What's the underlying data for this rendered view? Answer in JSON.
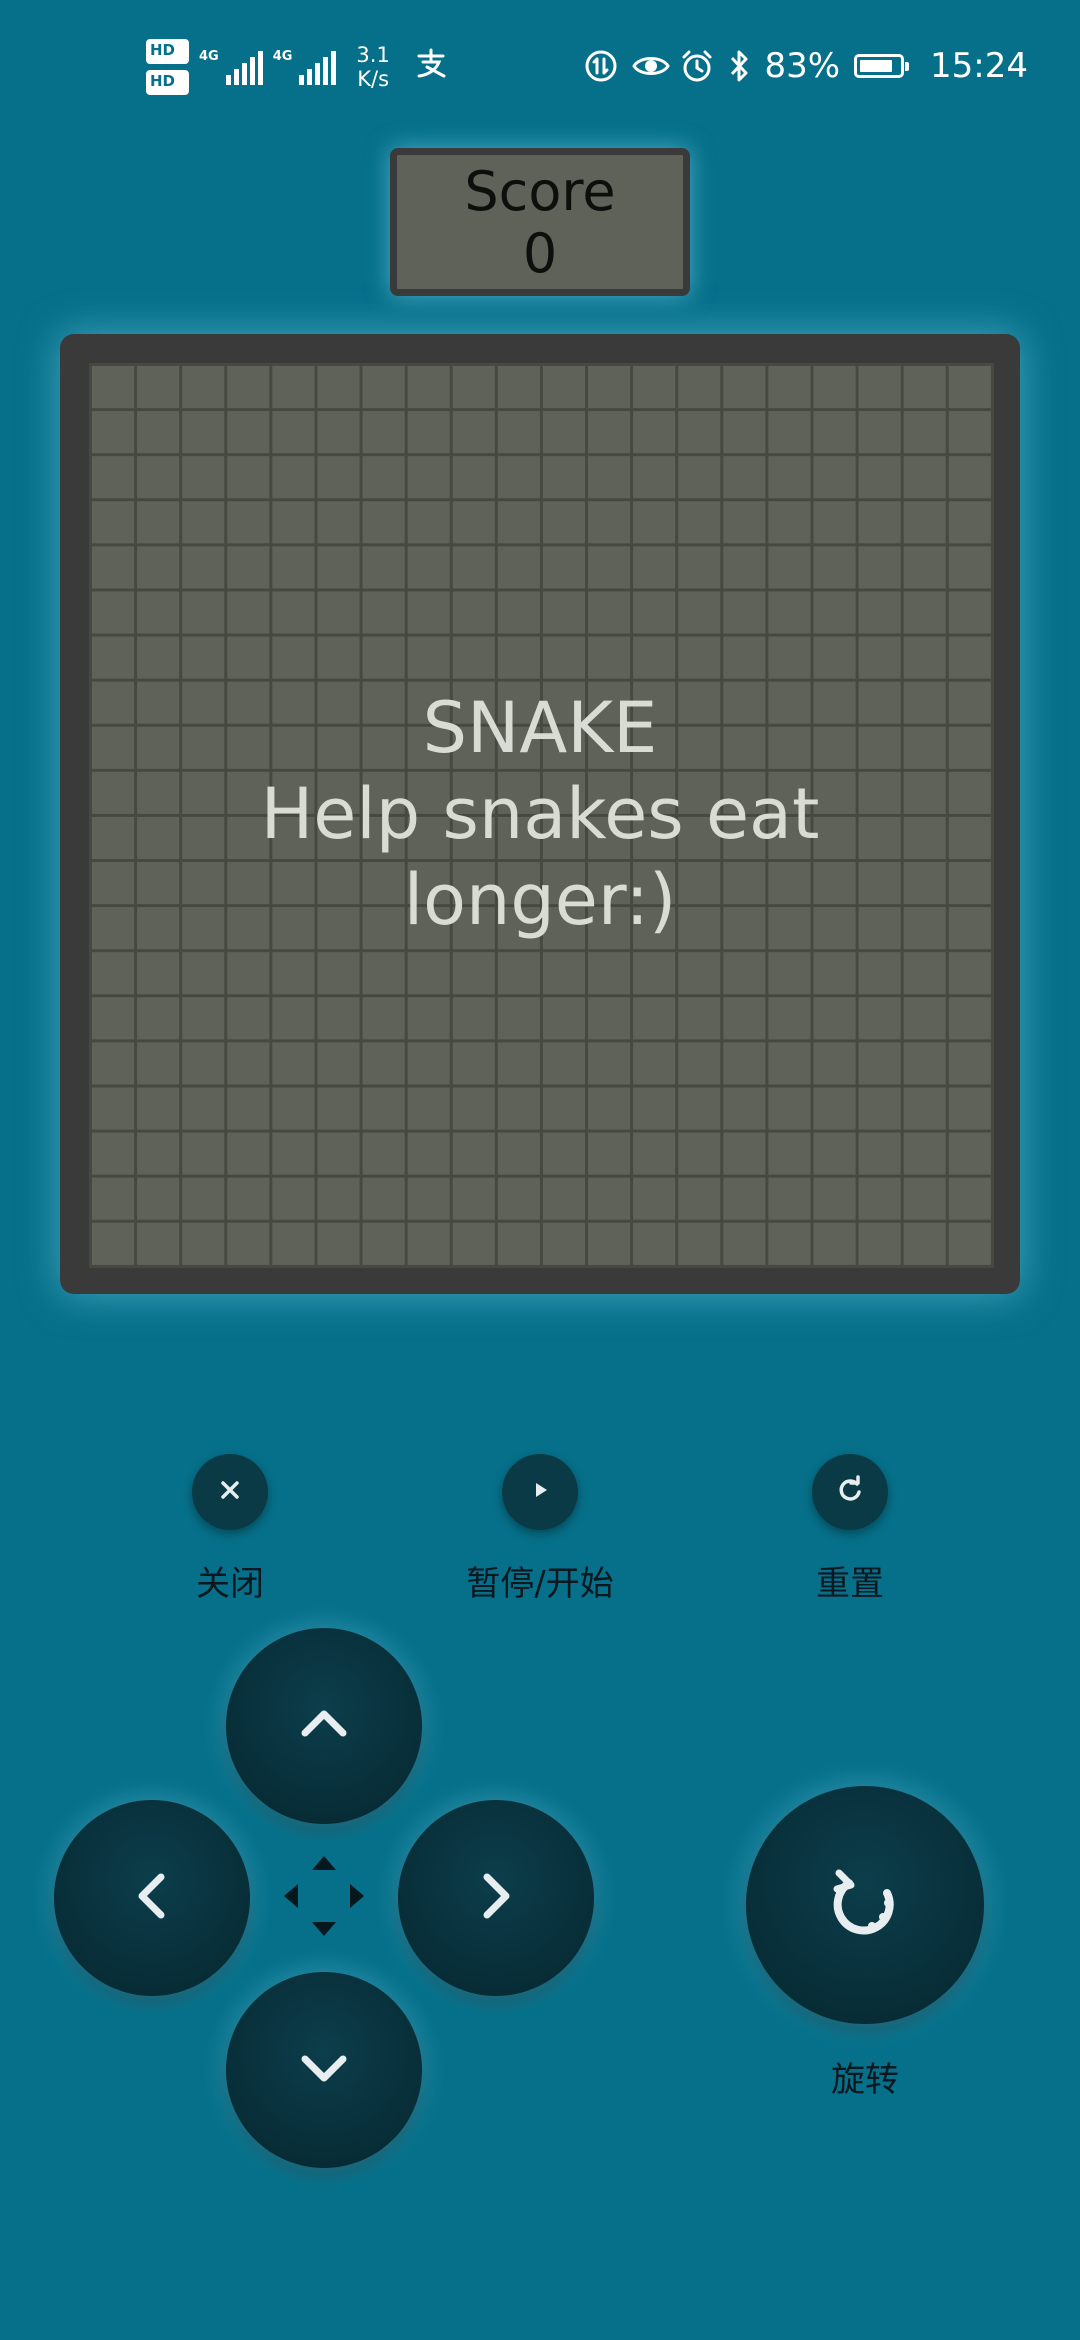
{
  "status_bar": {
    "hd1": "HD",
    "hd1_sub": "1",
    "hd2": "HD",
    "hd2_sub": "2",
    "net1": "4G",
    "net2": "4G",
    "speed_value": "3.1",
    "speed_unit": "K/s",
    "alipay_icon": "alipay-icon",
    "battery_percent": "83%",
    "battery_level": 0.83,
    "time": "15:24"
  },
  "score": {
    "label": "Score",
    "value": "0"
  },
  "board": {
    "columns": 20,
    "rows": 20,
    "title": "SNAKE",
    "subtitle": "Help snakes eat longer:)"
  },
  "controls": {
    "close_label": "关闭",
    "pause_label": "暂停/开始",
    "reset_label": "重置",
    "rotate_label": "旋转"
  },
  "icons": {
    "close": "close-icon",
    "play": "play-icon",
    "reset": "refresh-icon",
    "up": "chevron-up-icon",
    "down": "chevron-down-icon",
    "left": "chevron-left-icon",
    "right": "chevron-right-icon",
    "rotate": "rotate-icon",
    "center": "four-arrows-icon"
  },
  "colors": {
    "background": "#06708a",
    "board_frame": "#3a3a3a",
    "board_cell": "#5e6258",
    "button": "#072c36",
    "overlay_text": "#d8dcd4"
  }
}
